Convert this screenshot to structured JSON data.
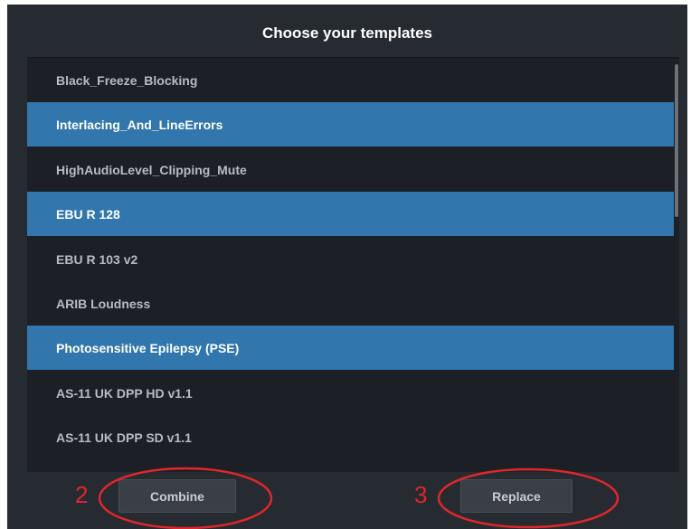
{
  "dialog": {
    "title": "Choose your templates",
    "templates": [
      {
        "label": "Black_Freeze_Blocking",
        "selected": false
      },
      {
        "label": "Interlacing_And_LineErrors",
        "selected": true
      },
      {
        "label": "HighAudioLevel_Clipping_Mute",
        "selected": false
      },
      {
        "label": "EBU R 128",
        "selected": true
      },
      {
        "label": "EBU R 103 v2",
        "selected": false
      },
      {
        "label": "ARIB Loudness",
        "selected": false
      },
      {
        "label": "Photosensitive Epilepsy (PSE)",
        "selected": true
      },
      {
        "label": "AS-11 UK DPP HD v1.1",
        "selected": false
      },
      {
        "label": "AS-11 UK DPP SD v1.1",
        "selected": false
      }
    ],
    "buttons": {
      "combine": "Combine",
      "replace": "Replace"
    }
  },
  "annotations": {
    "marker_combine": "2",
    "marker_replace": "3"
  },
  "colors": {
    "background": "#262b32",
    "list_background": "#1c2026",
    "selected_row": "#3176ac",
    "annotation_red": "#e0262b"
  }
}
